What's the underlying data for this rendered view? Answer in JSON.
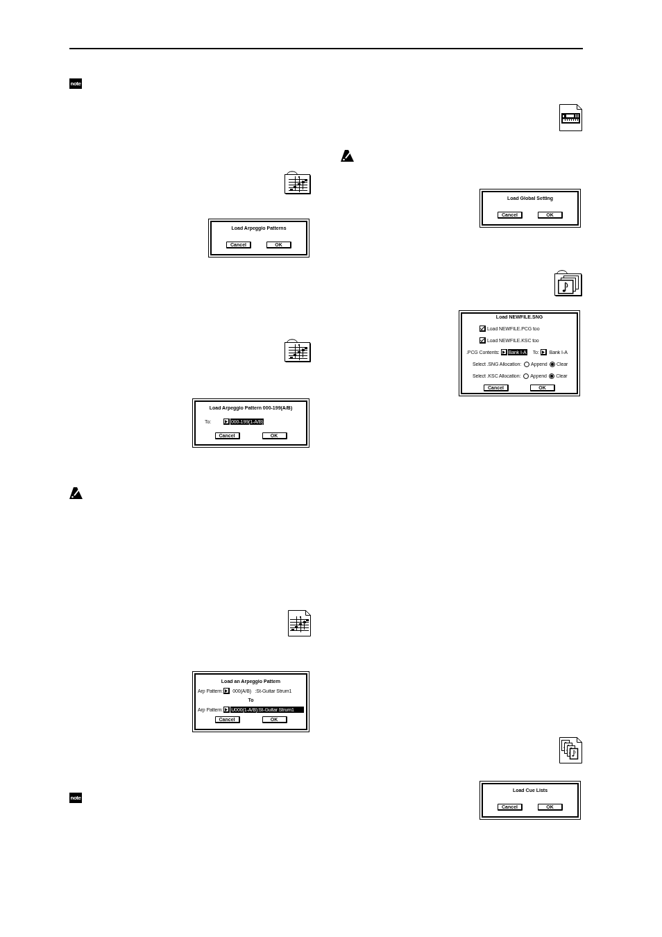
{
  "left_column": [
    {
      "kind": "note",
      "label": "note"
    },
    {
      "kind": "dialog",
      "title": "Load Arpeggio Patterns",
      "buttons": [
        "Cancel",
        "OK"
      ]
    },
    {
      "kind": "dialog",
      "title": "Load Arpeggio Pattern 000-199(A/B)",
      "rows": [
        {
          "kind": "select",
          "label": "To:",
          "value": "000-199(1-A/B)",
          "highlighted": true
        }
      ],
      "buttons": [
        "Cancel",
        "OK"
      ]
    },
    {
      "kind": "dialog",
      "title": "Load an Arpeggio Pattern",
      "rows": [
        {
          "kind": "select",
          "label": "Arp Pattern:",
          "value": "000(A/B)   :St-Guitar Strum1",
          "highlighted": false
        },
        {
          "kind": "caption",
          "text": "To"
        },
        {
          "kind": "select",
          "label": "Arp Pattern:",
          "value": "U000(1-A/B):St-Guitar Strum1",
          "highlighted": true
        }
      ],
      "buttons": [
        "Cancel",
        "OK"
      ]
    },
    {
      "kind": "note",
      "label": "note"
    }
  ],
  "right_column": [
    {
      "kind": "dialog",
      "title": "Load Global Setting",
      "buttons": [
        "Cancel",
        "OK"
      ]
    },
    {
      "kind": "dialog",
      "title": "Load NEWFILE.SNG",
      "rows": [
        {
          "kind": "checkbox",
          "label": "Load NEWFILE.PCG too",
          "checked": true
        },
        {
          "kind": "checkbox",
          "label": "Load NEWFILE.KSC too",
          "checked": true
        },
        {
          "kind": "selects",
          "items": [
            {
              "label": ".PCG Contents:",
              "value": "Bank I-A",
              "highlighted": true
            },
            {
              "label": "To:",
              "value": "Bank I-A",
              "highlighted": false
            }
          ]
        },
        {
          "kind": "radio_group",
          "label": "Select .SNG Allocation:",
          "options": [
            {
              "label": "Append",
              "selected": false
            },
            {
              "label": "Clear",
              "selected": true
            }
          ]
        },
        {
          "kind": "radio_group",
          "label": "Select .KSC Allocation:",
          "options": [
            {
              "label": "Append",
              "selected": false
            },
            {
              "label": "Clear",
              "selected": true
            }
          ]
        }
      ],
      "buttons": [
        "Cancel",
        "OK"
      ]
    },
    {
      "kind": "dialog",
      "title": "Load Cue Lists",
      "buttons": [
        "Cancel",
        "OK"
      ]
    }
  ]
}
